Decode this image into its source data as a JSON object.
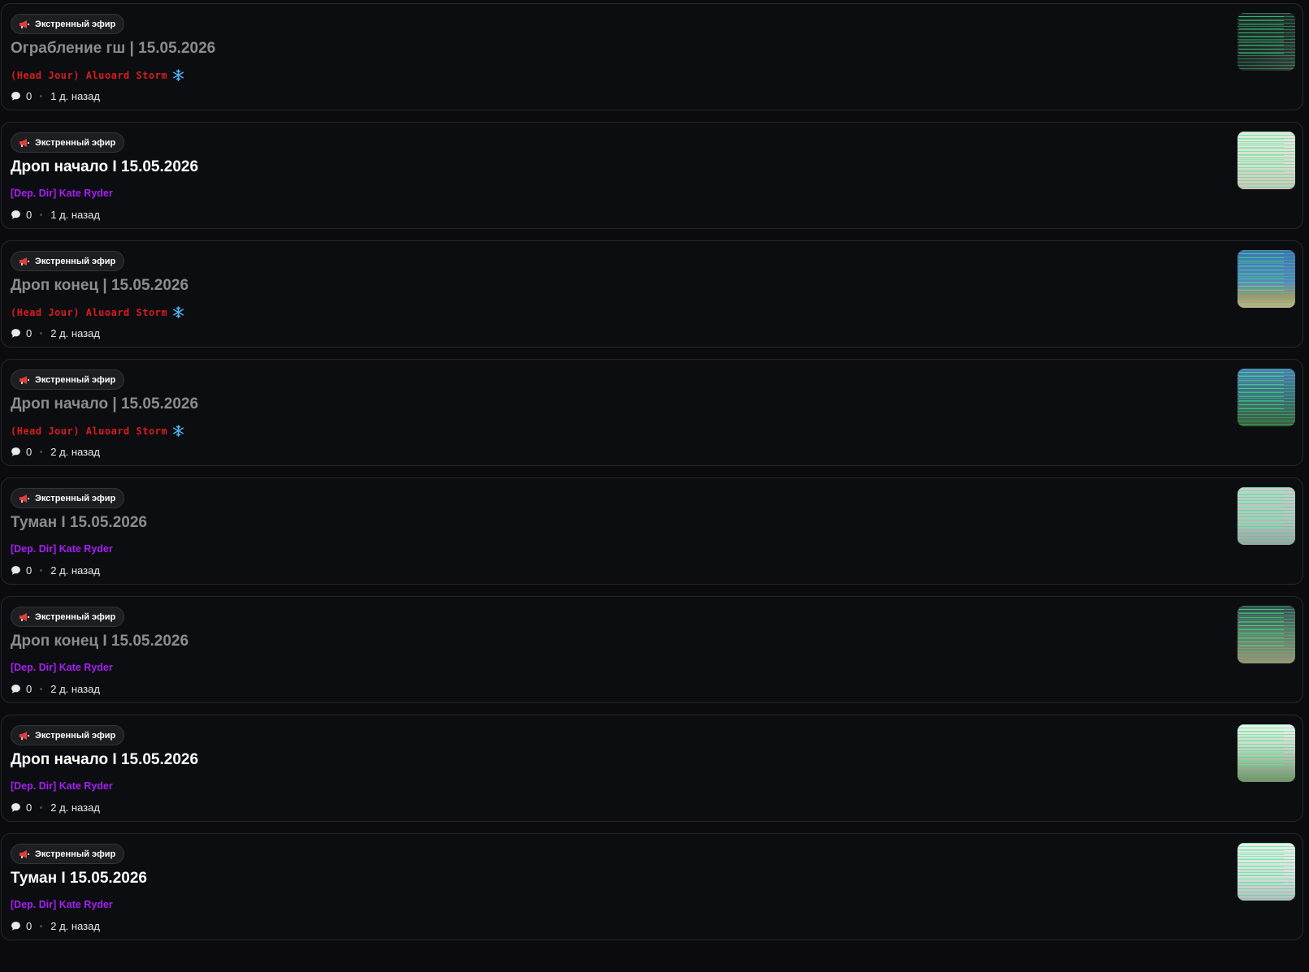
{
  "badge_label": "Экстренный эфир",
  "posts": [
    {
      "title": "Ограбление гш | 15.05.2026",
      "author": "(Head Jour) Aluoard Storm",
      "author_color": "#d61d1d",
      "author_style": "red",
      "title_dim": true,
      "has_snowflake": true,
      "comments": "0",
      "time": "1 д. назад",
      "thumb_bg": "linear-gradient(135deg,#1b2024 0%,#222a2c 55%,#3b3d40 100%)"
    },
    {
      "title": "Дроп начало I 15.05.2026",
      "author": "[Dep. Dir] Kate Ryder",
      "author_color": "#a61ef5",
      "author_style": "purple",
      "title_dim": false,
      "has_snowflake": false,
      "comments": "0",
      "time": "1 д. назад",
      "thumb_bg": "linear-gradient(180deg,#e6e8e2 0%,#d9dbd3 60%,#c9c7b8 100%)"
    },
    {
      "title": "Дроп конец | 15.05.2026",
      "author": "(Head Jour) Aluoard Storm",
      "author_color": "#d61d1d",
      "author_style": "red",
      "title_dim": true,
      "has_snowflake": true,
      "comments": "0",
      "time": "2 д. назад",
      "thumb_bg": "linear-gradient(180deg,#3f6fb8 0%,#5a85c3 55%,#a59370 80%,#c8b48a 100%)"
    },
    {
      "title": "Дроп начало | 15.05.2026",
      "author": "(Head Jour) Aluoard Storm",
      "author_color": "#d61d1d",
      "author_style": "red",
      "title_dim": true,
      "has_snowflake": true,
      "comments": "0",
      "time": "2 д. назад",
      "thumb_bg": "linear-gradient(180deg,#4f7eb8 0%,#3f6b7c 50%,#3c5f3a 100%)"
    },
    {
      "title": "Туман I 15.05.2026",
      "author": "[Dep. Dir] Kate Ryder",
      "author_color": "#a61ef5",
      "author_style": "purple",
      "title_dim": true,
      "has_snowflake": false,
      "comments": "0",
      "time": "2 д. назад",
      "thumb_bg": "linear-gradient(180deg,#c9cfd2 0%,#b8c1c4 60%,#9aa3a6 100%)"
    },
    {
      "title": "Дроп конец I 15.05.2026",
      "author": "[Dep. Dir] Kate Ryder",
      "author_color": "#a61ef5",
      "author_style": "purple",
      "title_dim": true,
      "has_snowflake": false,
      "comments": "0",
      "time": "2 д. назад",
      "thumb_bg": "linear-gradient(180deg,#384a55 0%,#5f7a6d 45%,#a08f78 100%)"
    },
    {
      "title": "Дроп начало I 15.05.2026",
      "author": "[Dep. Dir] Kate Ryder",
      "author_color": "#a61ef5",
      "author_style": "purple",
      "title_dim": false,
      "has_snowflake": false,
      "comments": "0",
      "time": "2 д. назад",
      "thumb_bg": "linear-gradient(180deg,#f2f4f4 0%,#c7cfc6 45%,#7a8b68 100%)"
    },
    {
      "title": "Туман I 15.05.2026",
      "author": "[Dep. Dir] Kate Ryder",
      "author_color": "#a61ef5",
      "author_style": "purple",
      "title_dim": false,
      "has_snowflake": false,
      "comments": "0",
      "time": "2 д. назад",
      "thumb_bg": "linear-gradient(180deg,#e9eced 0%,#d8dde0 60%,#b4bdc1 100%)"
    }
  ]
}
